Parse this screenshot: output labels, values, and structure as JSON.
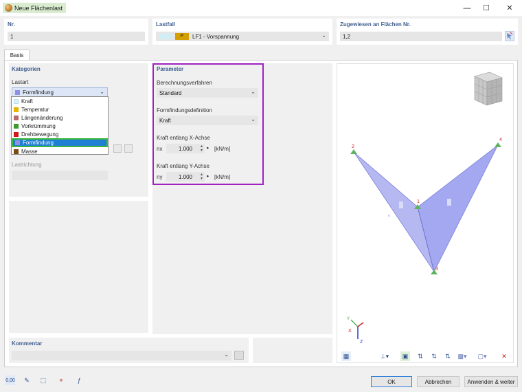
{
  "window": {
    "title": "Neue Flächenlast",
    "minimize": "—",
    "maximize": "☐",
    "close": "✕"
  },
  "header": {
    "nr_label": "Nr.",
    "nr_value": "1",
    "lastfall_label": "Lastfall",
    "lastfall_badge": "P",
    "lastfall_value": "LF1 - Vorspannung",
    "zugewiesen_label": "Zugewiesen an Flächen Nr.",
    "zugewiesen_value": "1,2"
  },
  "tabs": [
    {
      "label": "Basis"
    }
  ],
  "kategorien": {
    "title": "Kategorien",
    "lastart_label": "Lastart",
    "lastart_value": "Formfindung",
    "options": [
      {
        "label": "Kraft",
        "color": "#d7f1f7"
      },
      {
        "label": "Temperatur",
        "color": "#e8b400"
      },
      {
        "label": "Längenänderung",
        "color": "#b86a6a"
      },
      {
        "label": "Vorkrümmung",
        "color": "#3e9a2e"
      },
      {
        "label": "Drehbewegung",
        "color": "#d21a1a"
      },
      {
        "label": "Formfindung",
        "color": "#8f8fe8"
      },
      {
        "label": "Masse",
        "color": "#7a4a14"
      }
    ],
    "lastrichtung_label": "Lastrichtung"
  },
  "parameter": {
    "title": "Parameter",
    "berechnung_label": "Berechnungsverfahren",
    "berechnung_value": "Standard",
    "formfindung_label": "Formfindungsdefinition",
    "formfindung_value": "Kraft",
    "kraft_x_label": "Kraft entlang X-Achse",
    "nx_symbol": "nx",
    "nx_value": "1.000",
    "nx_unit": "[kN/m]",
    "kraft_y_label": "Kraft entlang Y-Achse",
    "ny_symbol": "ny",
    "ny_value": "1.000",
    "ny_unit": "[kN/m]"
  },
  "viewer": {
    "nodes": [
      "1",
      "2",
      "3",
      "4"
    ],
    "axes": {
      "x": "X",
      "y": "Y",
      "z": "Z"
    }
  },
  "kommentar": {
    "title": "Kommentar"
  },
  "buttons": {
    "ok": "OK",
    "cancel": "Abbrechen",
    "apply": "Anwenden & weiter"
  },
  "bottom_tools": {
    "units_label": "0,00"
  },
  "colors": {
    "highlight": "#a020c0",
    "selection_outline": "#3cb93c",
    "selection_bg": "#1f7fd4",
    "surface": "#9a9ff0"
  }
}
